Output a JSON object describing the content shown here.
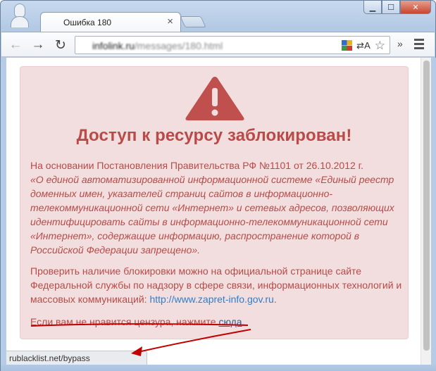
{
  "browser": {
    "tab_title": "Ошибка 180",
    "tab_close": "×",
    "url_host": "infolink.ru",
    "url_path": "/messages/180.html",
    "nav": {
      "back": "←",
      "forward": "→",
      "reload": "↻"
    },
    "toolbar_icons": {
      "translate": "⇄A",
      "star": "☆",
      "overflow": "»"
    },
    "window_controls": {
      "minimize": "▁",
      "maximize": "☐",
      "close": "✕"
    },
    "status_text": "rublacklist.net/bypass"
  },
  "alert": {
    "icon": "warning-triangle-icon",
    "title": "Доступ к ресурсу заблокирован!",
    "p1_lead": "На основании Постановления Правительства РФ №1101 от 26.10.2012 г.",
    "p1_quote": "«О единой автоматизированной информационной системе «Единый реестр доменных имен, указателей страниц сайтов в информационно-телекоммуникационной сети «Интернет» и сетевых адресов, позволяющих идентифицировать сайты в информационно-телекоммуникационной сети «Интернет», содержащие информацию, распространение которой в Российской Федерации запрещено».",
    "p2_text": "Проверить наличие блокировки можно на официальной странице сайте Федеральной службы по надзору в сфере связи, информационных технологий и массовых коммуникаций:",
    "p2_link": "http://www.zapret-info.gov.ru",
    "p2_tail": ".",
    "p3_text": "Если вам не нравится цензура, нажмите",
    "p3_link": "сюда",
    "p3_tail": "."
  },
  "colors": {
    "alert_bg": "#f2dede",
    "alert_text": "#b94a48",
    "link": "#2a7fd1",
    "annotation": "#c00000"
  }
}
